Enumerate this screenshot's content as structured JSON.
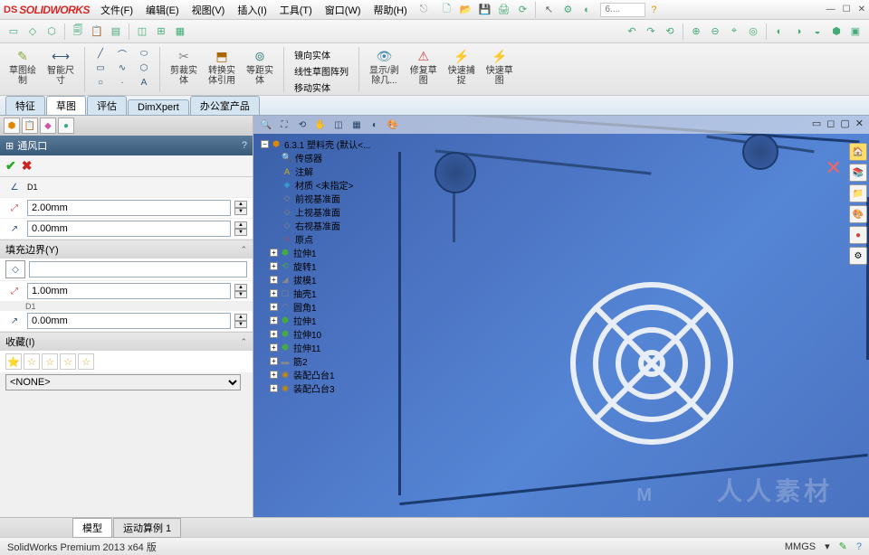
{
  "app": {
    "logo_prefix": "DS",
    "logo": "SOLIDWORKS",
    "version": "SolidWorks Premium 2013 x64 版"
  },
  "menu": {
    "file": "文件(F)",
    "edit": "编辑(E)",
    "view": "视图(V)",
    "insert": "插入(I)",
    "tools": "工具(T)",
    "window": "窗口(W)",
    "help": "帮助(H)"
  },
  "search_hint": "6....",
  "ribbon": {
    "sketch": "草图绘\n制",
    "smart_dim": "智能尺\n寸",
    "trim": "剪裁实\n体",
    "convert": "转换实\n体引用",
    "offset": "等距实\n体",
    "mirror": "镜向实体",
    "linear_pattern": "线性草图阵列",
    "move": "移动实体",
    "show_hide": "显示/剥\n除几...",
    "repair": "修复草\n图",
    "quick_snap": "快速捕\n捉",
    "rapid_sketch": "快速草\n图"
  },
  "tabs": {
    "t1": "特征",
    "t2": "草图",
    "t3": "评估",
    "t4": "DimXpert",
    "t5": "办公室产品"
  },
  "prop": {
    "title": "通风口",
    "d1_label": "D1",
    "d1_val": "2.00mm",
    "d2_val": "0.00mm",
    "fill_hdr": "填充边界(Y)",
    "f1_val": "1.00mm",
    "f2_val": "0.00mm",
    "fav_hdr": "收藏(I)",
    "none": "<NONE>"
  },
  "tree": {
    "root": "6.3.1 塑料壳 (默认<...",
    "items": [
      "传感器",
      "注解",
      "材质 <未指定>",
      "前视基准面",
      "上视基准面",
      "右视基准面",
      "原点",
      "拉伸1",
      "旋转1",
      "拔模1",
      "抽壳1",
      "圆角1",
      "拉伸1",
      "拉伸10",
      "拉伸11",
      "筋2",
      "装配凸台1",
      "装配凸台3"
    ]
  },
  "bottom_tabs": {
    "model": "模型",
    "motion": "运动算例 1"
  },
  "status": {
    "units": "MMGS"
  },
  "watermark": "人人素材",
  "wm_logo": "M"
}
